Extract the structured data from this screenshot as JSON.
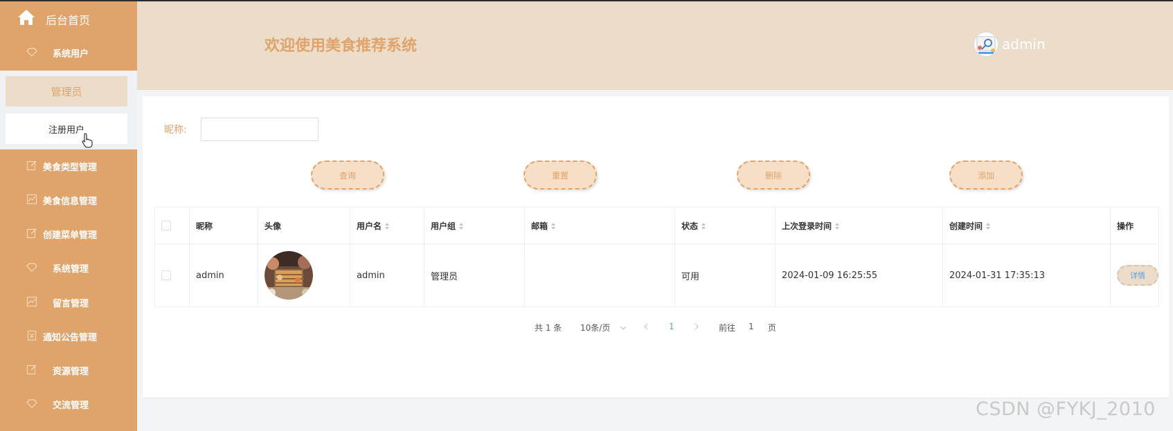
{
  "sidebar": {
    "home_label": "后台首页",
    "items": [
      {
        "label": "系统用户",
        "icon": "diamond-icon"
      },
      {
        "label": "美食类型管理",
        "icon": "edit-icon"
      },
      {
        "label": "美食信息管理",
        "icon": "chart-icon"
      },
      {
        "label": "创建菜单管理",
        "icon": "edit-icon"
      },
      {
        "label": "系统管理",
        "icon": "diamond-icon"
      },
      {
        "label": "留言管理",
        "icon": "chart-icon"
      },
      {
        "label": "通知公告管理",
        "icon": "currency-icon"
      },
      {
        "label": "资源管理",
        "icon": "edit-icon"
      },
      {
        "label": "交流管理",
        "icon": "diamond-icon"
      }
    ],
    "submenu": {
      "active": "管理员",
      "item": "注册用户"
    }
  },
  "header": {
    "title": "欢迎使用美食推荐系统",
    "username": "admin"
  },
  "search": {
    "label": "昵称:",
    "value": "",
    "placeholder": ""
  },
  "toolbar": {
    "query": "查询",
    "reset": "重置",
    "delete": "删除",
    "add": "添加"
  },
  "table": {
    "columns": [
      "昵称",
      "头像",
      "用户名",
      "用户组",
      "邮箱",
      "状态",
      "上次登录时间",
      "创建时间",
      "操作"
    ],
    "rows": [
      {
        "nickname": "admin",
        "username": "admin",
        "group": "管理员",
        "email": "",
        "status": "可用",
        "last_login": "2024-01-09 16:25:55",
        "created": "2024-01-31 17:35:13",
        "action": "详情"
      }
    ]
  },
  "pagination": {
    "total": "共 1 条",
    "page_size": "10条/页",
    "current_page": "1",
    "goto_prefix": "前往",
    "goto_value": "1",
    "goto_suffix": "页"
  },
  "watermark": "CSDN @FYKJ_2010",
  "colors": {
    "accent": "#e0a36a",
    "header_bg": "#ecdcca",
    "link": "#5aa0e6"
  }
}
